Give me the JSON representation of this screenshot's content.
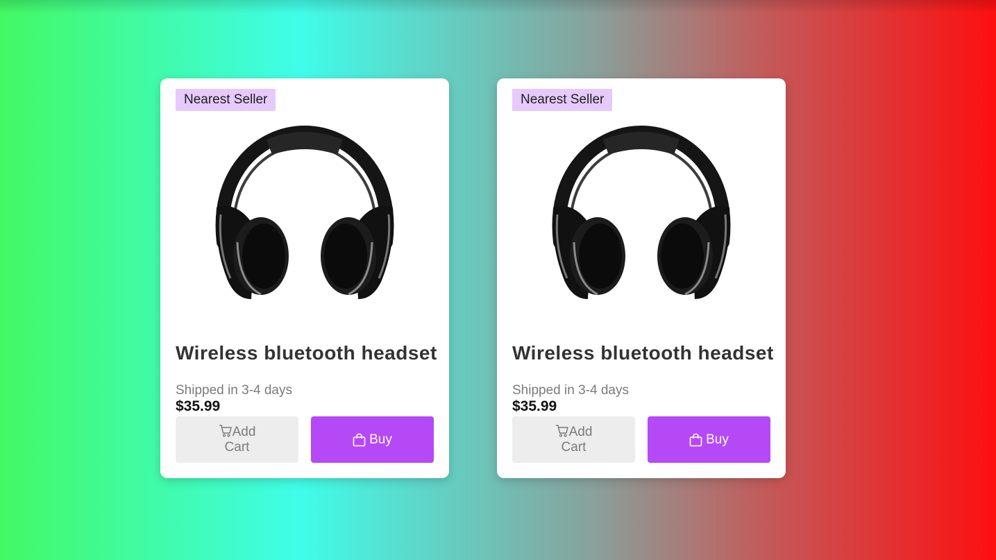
{
  "colors": {
    "badge_bg": "#e6cafb",
    "buy_button_bg": "#b549f6",
    "add_cart_button_bg": "#ededed",
    "card_bg": "#ffffff"
  },
  "products": [
    {
      "badge": "Nearest Seller",
      "image_icon": "headphones-image",
      "title": "Wireless bluetooth headset",
      "shipping": "Shipped in 3-4 days",
      "price": "$35.99",
      "add_cart_label_1": "Add",
      "add_cart_label_2": "Cart",
      "add_cart_icon": "cart-icon",
      "buy_label": "Buy",
      "buy_icon": "shopping-bag-icon"
    },
    {
      "badge": "Nearest Seller",
      "image_icon": "headphones-image",
      "title": "Wireless bluetooth headset",
      "shipping": "Shipped in 3-4 days",
      "price": "$35.99",
      "add_cart_label_1": "Add",
      "add_cart_label_2": "Cart",
      "add_cart_icon": "cart-icon",
      "buy_label": "Buy",
      "buy_icon": "shopping-bag-icon"
    }
  ]
}
